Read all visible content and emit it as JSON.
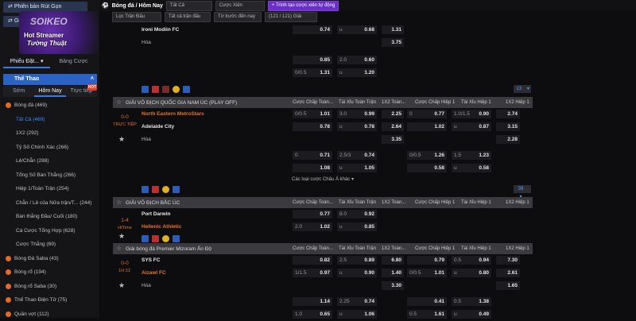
{
  "left": {
    "withdraw_btn": "Phiên bản Rút Gọn",
    "deposit_btn": "Gửi tiền",
    "banner_logo": "SOIKEO",
    "banner_line1": "Hot Streamer",
    "banner_line2": "Tường Thuật",
    "tab_bet_slip": "Phiếu Đặt...",
    "tab_odds_table": "Bảng Cược",
    "sport_header": "Thể Thao",
    "tab_early": "Sớm",
    "tab_today": "Hôm Nay",
    "tab_live": "Trực tiếp",
    "live_badge": "HOT",
    "menu": [
      {
        "label": "Bóng đá (469)",
        "sub": false,
        "sel": false
      },
      {
        "label": "Tất Cả (469)",
        "sub": true,
        "sel": true
      },
      {
        "label": "1X2 (292)",
        "sub": true,
        "sel": false
      },
      {
        "label": "Tỷ Số Chính Xác (266)",
        "sub": true,
        "sel": false
      },
      {
        "label": "Lẻ/Chẵn (288)",
        "sub": true,
        "sel": false
      },
      {
        "label": "Tổng Số Bàn Thắng (266)",
        "sub": true,
        "sel": false
      },
      {
        "label": "Hiệp 1/Toàn Trận (254)",
        "sub": true,
        "sel": false
      },
      {
        "label": "Chẵn / Lẻ của Nửa trận/T... (244)",
        "sub": true,
        "sel": false
      },
      {
        "label": "Bàn thắng Đầu/ Cuối (180)",
        "sub": true,
        "sel": false
      },
      {
        "label": "Cá Cược Tổng Hợp (628)",
        "sub": true,
        "sel": false
      },
      {
        "label": "Cược Thắng (69)",
        "sub": true,
        "sel": false
      },
      {
        "label": "Bóng Đá Saba (43)",
        "sub": false,
        "sel": false
      },
      {
        "label": "Bóng rổ (194)",
        "sub": false,
        "sel": false
      },
      {
        "label": "Bóng rổ Saba (30)",
        "sub": false,
        "sel": false
      },
      {
        "label": "Thể Thao Điện Tử (75)",
        "sub": false,
        "sel": false
      },
      {
        "label": "Quần vợt (112)",
        "sub": false,
        "sel": false
      }
    ]
  },
  "top": {
    "breadcrumb": "Bóng đá / Hôm Nay",
    "filter_all": "Tất Cả",
    "filter_parlay": "Cược Xiên",
    "create_parlay": "Trình tạo cược xiên tự động",
    "select_league": "Lọc Trận Đấu",
    "select_match": "Tất cả trận đấu",
    "select_time": "Từ trước đến nay",
    "count": "(121 / 121) Giải"
  },
  "columns": [
    "Cược Chấp Toàn...",
    "Tài Xỉu Toàn Trận",
    "1X2 Toàn...",
    "Cược Chấp Hiệp 1",
    "Tài Xỉu Hiệp 1",
    "1X2 Hiệp 1"
  ],
  "block1": {
    "team": "Ironi Modiin FC",
    "draw": "Hòa",
    "r1": [
      "",
      "0.74",
      "u",
      "0.68",
      "1.31"
    ],
    "r2": [
      "3.75"
    ],
    "r3": [
      "",
      "0.85",
      "2.0",
      "0.60"
    ],
    "r4": [
      "0/0.5",
      "1.31",
      "u",
      "1.20"
    ],
    "more": "13"
  },
  "league2": {
    "name": "GIẢI VÔ ĐỊCH QUỐC GIA NAM ÚC (PLAY OFF)",
    "score": "0-0",
    "status": "TRỰC TIẾP",
    "home": "North Eastern MetroStars",
    "away": "Adelaide City",
    "draw": "Hòa",
    "h": [
      "0/0.5",
      "1.01",
      "3.0",
      "0.99",
      "2.25",
      "0",
      "0.77",
      "1.0/1.5",
      "0.90",
      "2.74"
    ],
    "a": [
      "",
      "0.78",
      "u",
      "0.78",
      "2.64",
      "",
      "1.02",
      "u",
      "0.87",
      "3.15"
    ],
    "d": [
      "3.35",
      "2.28"
    ],
    "x1": [
      "0",
      "0.71",
      "2.5/3",
      "0.74",
      "",
      "0/0.5",
      "1.26",
      "1.5",
      "1.23",
      ""
    ],
    "x2": [
      "",
      "1.08",
      "u",
      "1.05",
      "",
      "",
      "0.58",
      "u",
      "0.58",
      ""
    ],
    "asian_more": "Các loại cược Châu Á khác",
    "more": "39"
  },
  "league3": {
    "name": "GIẢI VÔ ĐỊCH BẮC ÚC",
    "score": "1-4",
    "status": "HtTime",
    "home": "Port Darwin",
    "away": "Hellenic Athletic",
    "h": [
      "",
      "0.77",
      "8.0",
      "0.92"
    ],
    "a": [
      "2.0",
      "1.02",
      "u",
      "0.85"
    ]
  },
  "league4": {
    "name": "Giải bóng đá Premier Mizoram Ấn Độ",
    "score": "0-0",
    "status": "1H 31'",
    "home": "SYS FC",
    "away": "Aizawl FC",
    "draw": "Hòa",
    "h": [
      "",
      "0.82",
      "2.5",
      "0.89",
      "6.80",
      "",
      "0.79",
      "0.5",
      "0.94",
      "7.30"
    ],
    "a": [
      "1/1.5",
      "0.97",
      "u",
      "0.90",
      "1.40",
      "0/0.5",
      "1.01",
      "u",
      "0.80",
      "2.61"
    ],
    "d": [
      "3.30",
      "1.65"
    ],
    "x1": [
      "",
      "1.14",
      "2.25",
      "0.74",
      "",
      "",
      "0.41",
      "0.5",
      "1.38",
      ""
    ],
    "x2": [
      "1.0",
      "0.65",
      "u",
      "1.06",
      "",
      "0.5",
      "1.61",
      "u",
      "0.49",
      ""
    ]
  }
}
